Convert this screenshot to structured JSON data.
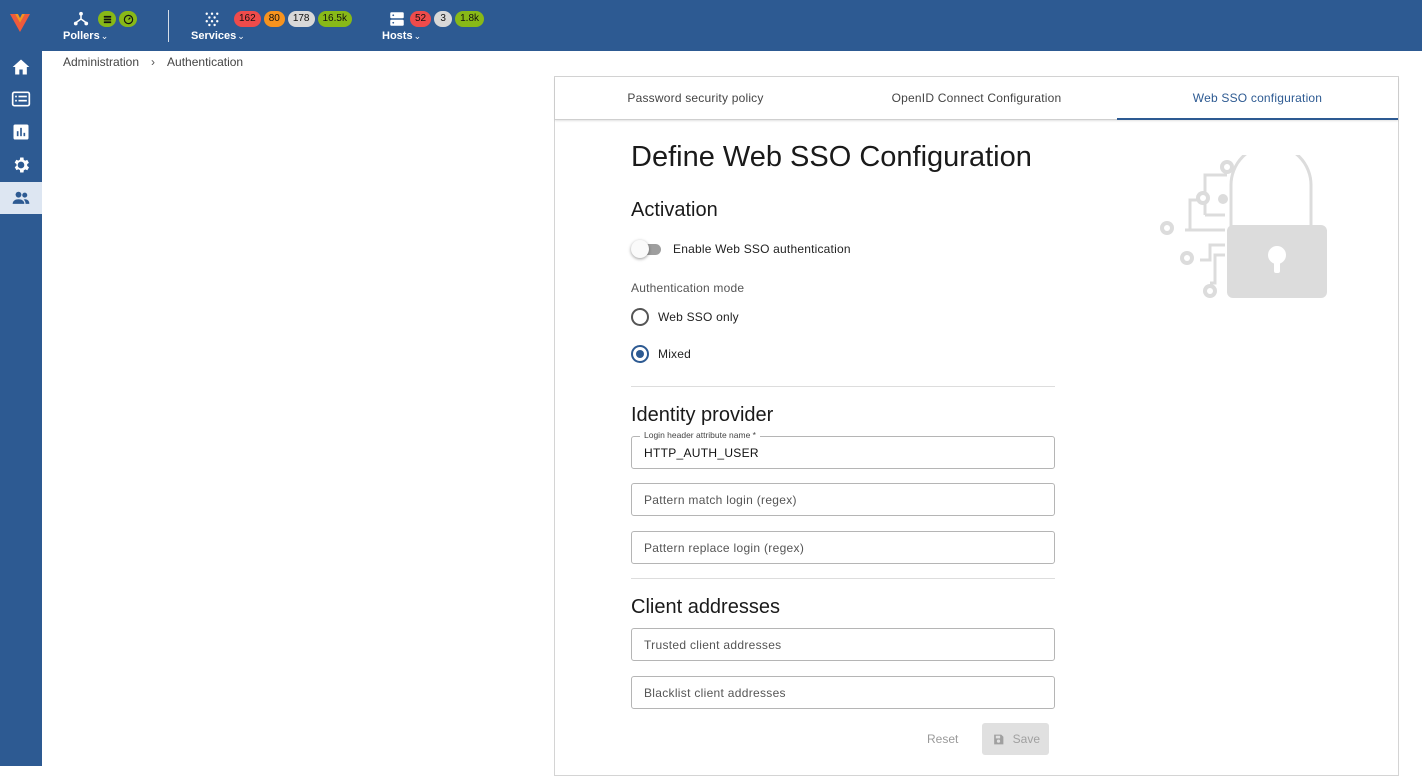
{
  "header": {
    "pollers": {
      "label": "Pollers"
    },
    "services": {
      "label": "Services",
      "badges": [
        "162",
        "80",
        "178",
        "16.5k"
      ]
    },
    "hosts": {
      "label": "Hosts",
      "badges": [
        "52",
        "3",
        "1.8k"
      ]
    }
  },
  "breadcrumb": {
    "items": [
      "Administration",
      "Authentication"
    ]
  },
  "tabs": [
    {
      "label": "Password security policy"
    },
    {
      "label": "OpenID Connect Configuration"
    },
    {
      "label": "Web SSO configuration"
    }
  ],
  "form": {
    "title": "Define Web SSO Configuration",
    "activation": {
      "heading": "Activation",
      "toggle_label": "Enable Web SSO authentication",
      "enabled": false
    },
    "auth_mode": {
      "label": "Authentication mode",
      "options": [
        "Web SSO only",
        "Mixed"
      ],
      "selected": "Mixed"
    },
    "identity_provider": {
      "heading": "Identity provider",
      "login_header_label": "Login header attribute name *",
      "login_header_value": "HTTP_AUTH_USER",
      "pattern_match_placeholder": "Pattern match login (regex)",
      "pattern_replace_placeholder": "Pattern replace login (regex)"
    },
    "client_addresses": {
      "heading": "Client addresses",
      "trusted_placeholder": "Trusted client addresses",
      "blacklist_placeholder": "Blacklist client addresses"
    },
    "reset_label": "Reset",
    "save_label": "Save"
  },
  "colors": {
    "brand": "#2d5a92",
    "badge_critical": "#ef4b4b",
    "badge_warning": "#f7931e",
    "badge_unknown": "#d8d8d8",
    "badge_ok": "#88b917"
  }
}
